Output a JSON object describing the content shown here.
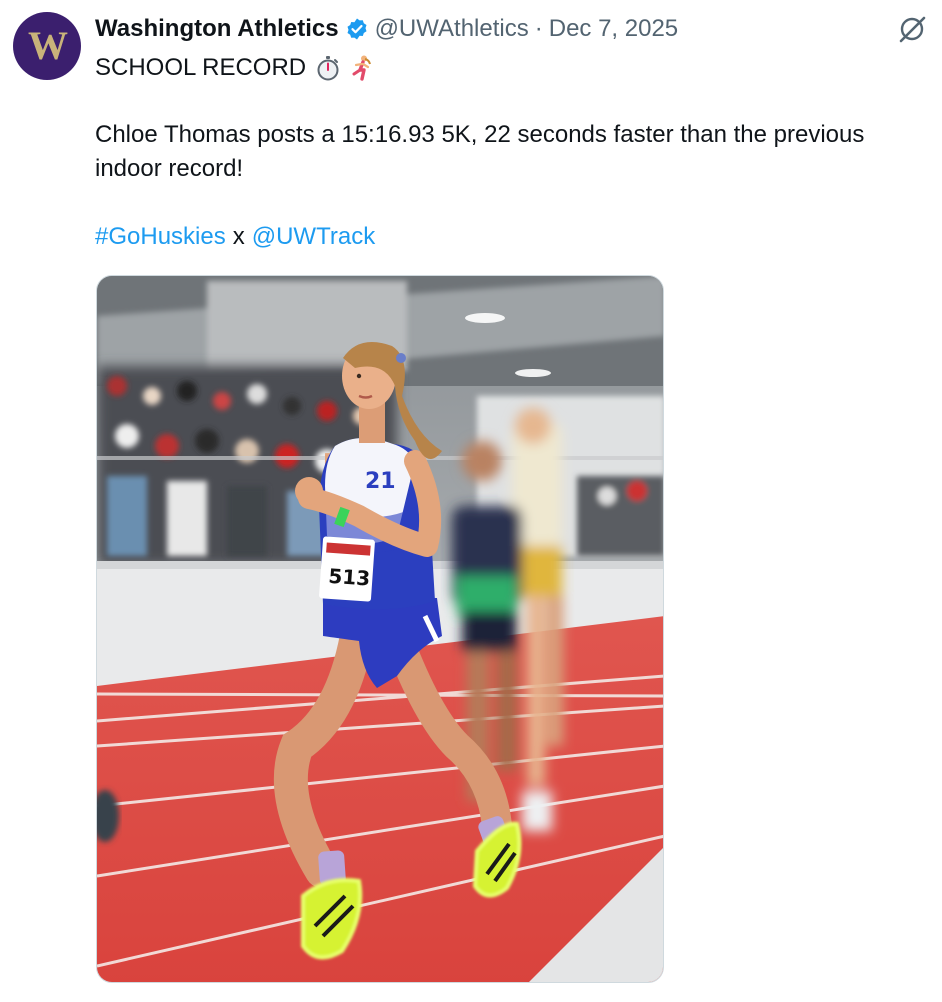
{
  "author": {
    "display_name": "Washington Athletics",
    "handle": "@UWAthletics",
    "separator": "·",
    "date": "Dec 7, 2025",
    "avatar_letter": "W",
    "verified_icon": "verified-badge-icon",
    "brand_color": "#3b1f6e"
  },
  "post": {
    "headline": "SCHOOL RECORD",
    "headline_emojis": [
      "stopwatch-icon",
      "woman-running-icon"
    ],
    "body": "Chloe Thomas posts a 15:16.93 5K, 22 seconds faster than the previous indoor record!",
    "hashtag": "#GoHuskies",
    "conjunction": "x",
    "mention": "@UWTrack",
    "link_color": "#1d9bf0"
  },
  "media": {
    "bib_number": "513",
    "jersey_number": "21",
    "track_color": "#d84b47",
    "uniform_color": "#2b3fbf"
  }
}
